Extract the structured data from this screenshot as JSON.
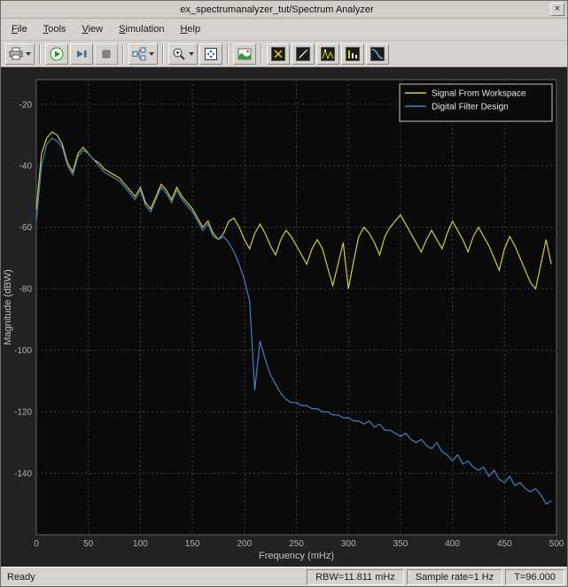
{
  "window": {
    "title": "ex_spectrumanalyzer_tut/Spectrum Analyzer",
    "close_label": "×"
  },
  "menu": {
    "items": [
      {
        "label": "File"
      },
      {
        "label": "Tools"
      },
      {
        "label": "View"
      },
      {
        "label": "Simulation"
      },
      {
        "label": "Help"
      }
    ]
  },
  "toolbar": {
    "icons": [
      "print-icon",
      "run-icon",
      "step-forward-icon",
      "stop-icon",
      "simulation-settings-icon",
      "zoom-in-icon",
      "fit-to-view-icon",
      "spectrum-settings-icon",
      "cursor-measurements-icon",
      "signal-statistics-icon",
      "peak-finder-icon",
      "distortion-measurements-icon",
      "ccdf-measurements-icon"
    ]
  },
  "status": {
    "ready": "Ready",
    "rbw": "RBW=11.811 mHz",
    "sample_rate": "Sample rate=1 Hz",
    "time": "T=96.000"
  },
  "chart_data": {
    "type": "line",
    "title": "",
    "xlabel": "Frequency (mHz)",
    "ylabel": "Magnitude (dBW)",
    "xlim": [
      0,
      500
    ],
    "ylim": [
      -160,
      -12
    ],
    "xticks": [
      0,
      50,
      100,
      150,
      200,
      250,
      300,
      350,
      400,
      450,
      500
    ],
    "yticks": [
      -20,
      -40,
      -60,
      -80,
      -100,
      -120,
      -140
    ],
    "grid": true,
    "legend_position": "top-right",
    "background": "#0a0a0a",
    "grid_color": "#3f3f3f",
    "tick_color": "#b0b0b0",
    "x": [
      0,
      5,
      10,
      15,
      20,
      25,
      30,
      35,
      40,
      45,
      50,
      55,
      60,
      65,
      70,
      75,
      80,
      85,
      90,
      95,
      100,
      105,
      110,
      115,
      120,
      125,
      130,
      135,
      140,
      145,
      150,
      155,
      160,
      165,
      170,
      175,
      180,
      185,
      190,
      195,
      200,
      205,
      210,
      215,
      220,
      225,
      230,
      235,
      240,
      245,
      250,
      255,
      260,
      265,
      270,
      275,
      280,
      285,
      290,
      295,
      300,
      305,
      310,
      315,
      320,
      325,
      330,
      335,
      340,
      345,
      350,
      355,
      360,
      365,
      370,
      375,
      380,
      385,
      390,
      395,
      400,
      405,
      410,
      415,
      420,
      425,
      430,
      435,
      440,
      445,
      450,
      455,
      460,
      465,
      470,
      475,
      480,
      485,
      490,
      495
    ],
    "series": [
      {
        "name": "Signal From Workspace",
        "color": "#d4cc3a",
        "values": [
          -54,
          -36,
          -31,
          -29,
          -30,
          -33,
          -39,
          -42,
          -36,
          -34,
          -36,
          -38,
          -39,
          -41,
          -42,
          -43,
          -44,
          -46,
          -48,
          -50,
          -47,
          -52,
          -54,
          -50,
          -46,
          -48,
          -51,
          -47,
          -50,
          -52,
          -54,
          -57,
          -60,
          -58,
          -62,
          -64,
          -62,
          -58,
          -57,
          -60,
          -64,
          -67,
          -62,
          -59,
          -62,
          -66,
          -69,
          -64,
          -61,
          -63,
          -66,
          -69,
          -72,
          -67,
          -64,
          -67,
          -73,
          -79,
          -72,
          -65,
          -80,
          -71,
          -63,
          -60,
          -62,
          -65,
          -69,
          -63,
          -60,
          -58,
          -56,
          -59,
          -62,
          -65,
          -68,
          -64,
          -61,
          -64,
          -67,
          -62,
          -58,
          -61,
          -64,
          -68,
          -63,
          -60,
          -63,
          -66,
          -70,
          -74,
          -67,
          -63,
          -66,
          -70,
          -74,
          -78,
          -80,
          -72,
          -64,
          -72
        ]
      },
      {
        "name": "Digital Filter Design",
        "color": "#4181c4",
        "values": [
          -58,
          -40,
          -33,
          -31,
          -32,
          -34,
          -40,
          -43,
          -37,
          -35,
          -36,
          -38,
          -40,
          -42,
          -43,
          -44,
          -45,
          -47,
          -49,
          -51,
          -48,
          -53,
          -55,
          -51,
          -47,
          -49,
          -52,
          -48,
          -51,
          -53,
          -55,
          -58,
          -61,
          -59,
          -63,
          -64,
          -63,
          -65,
          -68,
          -72,
          -77,
          -84,
          -113,
          -97,
          -103,
          -108,
          -111,
          -114,
          -116,
          -117,
          -117,
          -118,
          -118,
          -119,
          -119,
          -120,
          -120,
          -121,
          -121,
          -122,
          -122,
          -123,
          -123,
          -124,
          -123,
          -125,
          -124,
          -126,
          -126,
          -127,
          -128,
          -127,
          -129,
          -130,
          -129,
          -131,
          -132,
          -130,
          -133,
          -134,
          -136,
          -134,
          -137,
          -136,
          -138,
          -139,
          -138,
          -141,
          -139,
          -142,
          -143,
          -141,
          -144,
          -143,
          -145,
          -146,
          -145,
          -147,
          -150,
          -149
        ]
      }
    ]
  }
}
